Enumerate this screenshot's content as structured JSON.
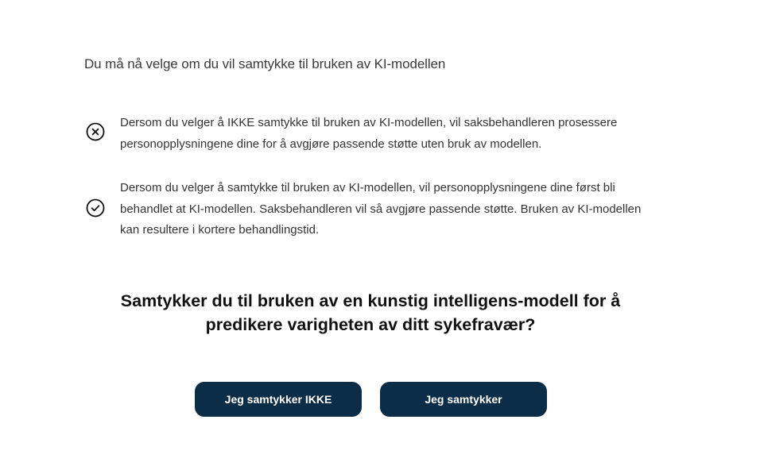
{
  "intro": {
    "text": "Du må nå velge om du vil samtykke til bruken av KI-modellen"
  },
  "options": [
    {
      "icon": "circle-x-icon",
      "text": "Dersom du velger å IKKE samtykke til bruken av KI-modellen, vil saksbehandleren prosessere personopplysningene dine for å avgjøre passende støtte uten bruk av modellen."
    },
    {
      "icon": "circle-check-icon",
      "text": "Dersom du velger å samtykke til bruken av KI-modellen, vil personopplysningene dine først bli behandlet at KI-modellen. Saksbehandleren vil så avgjøre passende støtte. Bruken av KI-modellen kan resultere i kortere behandlingstid."
    }
  ],
  "question": {
    "text": "Samtykker du til bruken av en kunstig intelligens-modell for å predikere varigheten av ditt sykefravær?"
  },
  "buttons": {
    "decline_label": "Jeg samtykker IKKE",
    "accept_label": "Jeg samtykker",
    "color": "#0b2d48"
  }
}
